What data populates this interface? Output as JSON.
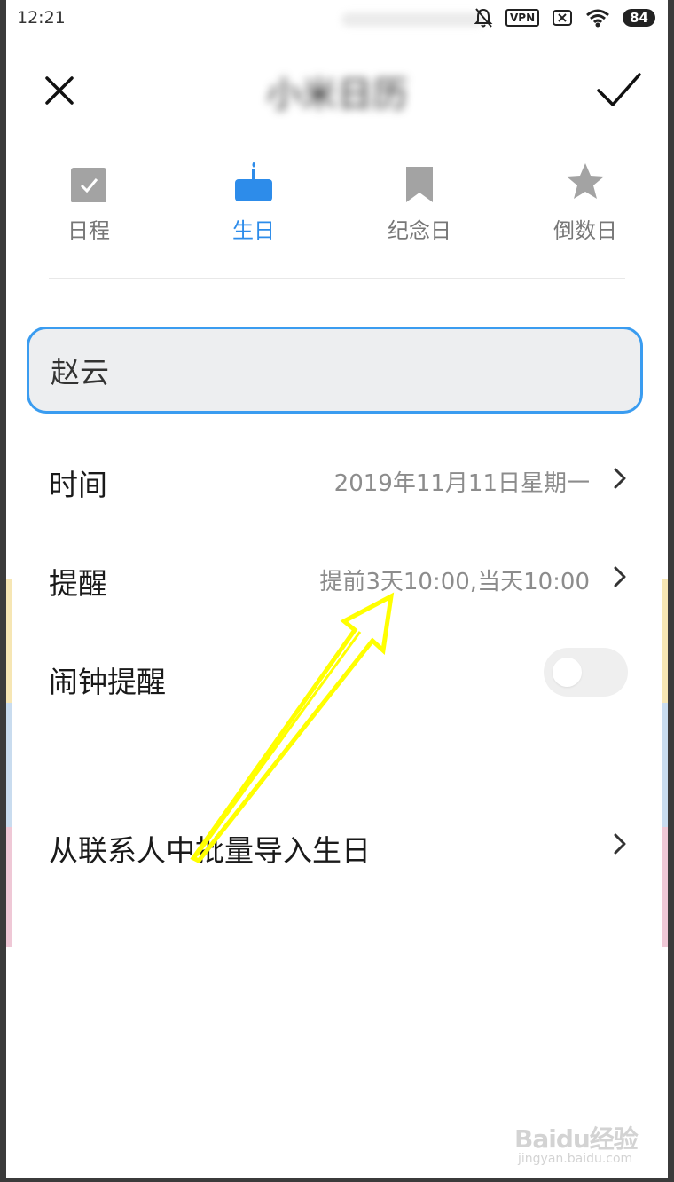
{
  "status_bar": {
    "time": "12:21",
    "vpn": "VPN",
    "battery": "84",
    "icons": [
      "bell-off-icon",
      "vpn-icon",
      "sim-x-icon",
      "wifi-icon",
      "battery-icon"
    ]
  },
  "header": {
    "title": "小米日历",
    "close_icon": "close-icon",
    "confirm_icon": "check-icon"
  },
  "tabs": [
    {
      "label": "日程",
      "icon": "checkbox-icon",
      "active": false
    },
    {
      "label": "生日",
      "icon": "cake-icon",
      "active": true
    },
    {
      "label": "纪念日",
      "icon": "bookmark-icon",
      "active": false
    },
    {
      "label": "倒数日",
      "icon": "star-icon",
      "active": false
    }
  ],
  "name_field": {
    "value": "赵云"
  },
  "time_row": {
    "label": "时间",
    "value": "2019年11月11日星期一"
  },
  "reminder_row": {
    "label": "提醒",
    "value": "提前3天10:00,当天10:00"
  },
  "alarm_row": {
    "label": "闹钟提醒",
    "toggle_on": false
  },
  "import_row": {
    "label": "从联系人中批量导入生日"
  },
  "watermark": {
    "logo": "Baidu经验",
    "url": "jingyan.baidu.com"
  },
  "colors": {
    "accent": "#2d8cea",
    "field_border": "#3a9cf0",
    "inactive_icon": "#a3a3a3",
    "annotation_arrow": "#ffff00"
  }
}
